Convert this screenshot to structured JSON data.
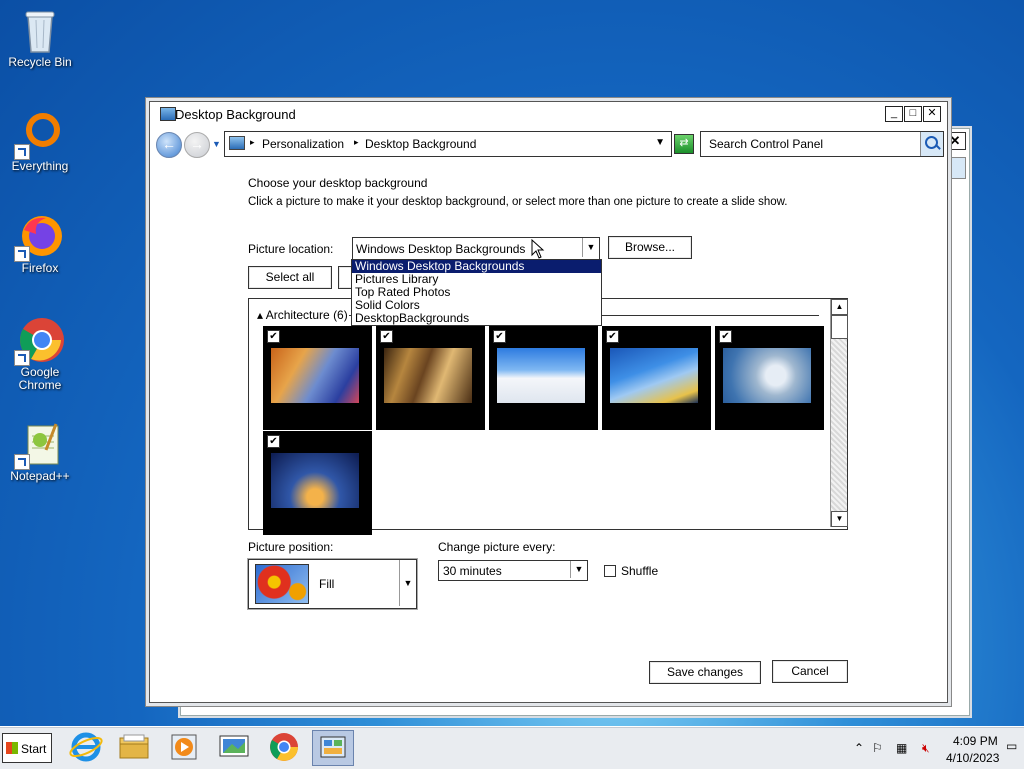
{
  "desktop": {
    "icons": [
      {
        "label": "Recycle Bin"
      },
      {
        "label": "Everything"
      },
      {
        "label": "Firefox"
      },
      {
        "label": "Google Chrome"
      },
      {
        "label": "Notepad++"
      }
    ]
  },
  "window": {
    "title": "Desktop Background",
    "controls": {
      "minimize": "_",
      "maximize": "□",
      "close": "✕"
    },
    "address": {
      "crumbs": [
        "Personalization",
        "Desktop Background"
      ],
      "search_placeholder": "Search Control Panel"
    },
    "heading": "Choose your desktop background",
    "description": "Click a picture to make it your desktop background, or select more than one picture to create a slide show.",
    "picture_location": {
      "label": "Picture location:",
      "value": "Windows Desktop Backgrounds",
      "options": [
        "Windows Desktop Backgrounds",
        "Pictures Library",
        "Top Rated Photos",
        "Solid Colors",
        "DesktopBackgrounds"
      ]
    },
    "browse_label": "Browse...",
    "select_all_label": "Select all",
    "group": {
      "title": "Architecture (6)",
      "thumbnails": [
        {
          "checked": true
        },
        {
          "checked": true
        },
        {
          "checked": true
        },
        {
          "checked": true
        },
        {
          "checked": true
        },
        {
          "checked": true
        }
      ]
    },
    "picture_position": {
      "label": "Picture position:",
      "value": "Fill"
    },
    "change_every": {
      "label": "Change picture every:",
      "value": "30 minutes"
    },
    "shuffle": {
      "label": "Shuffle",
      "checked": false
    },
    "save_label": "Save changes",
    "cancel_label": "Cancel"
  },
  "taskbar": {
    "start_label": "Start",
    "apps": [
      "internet-explorer-icon",
      "file-explorer-icon",
      "media-player-icon",
      "display-icon",
      "chrome-icon",
      "control-panel-icon"
    ],
    "time": "4:09 PM",
    "date": "4/10/2023"
  }
}
